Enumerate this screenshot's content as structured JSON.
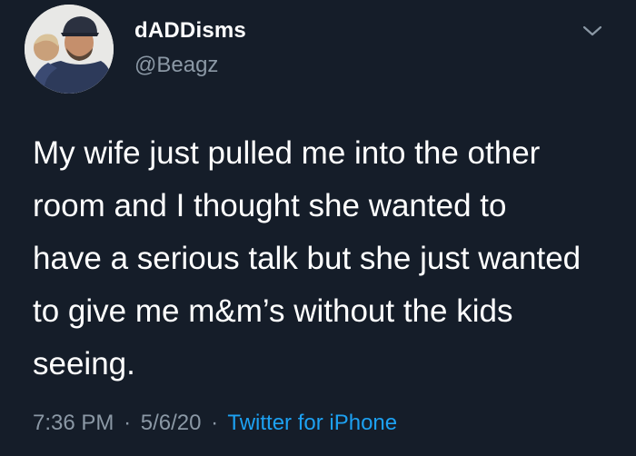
{
  "author": {
    "display_name": "dADDisms",
    "handle": "@Beagz"
  },
  "tweet": {
    "lines": [
      "My wife just pulled me into the other",
      "room and I thought she wanted to",
      "have a serious talk but she just wanted",
      "to give me m&m’s without the kids",
      "seeing."
    ]
  },
  "meta": {
    "time": "7:36 PM",
    "separator": "·",
    "date": "5/6/20",
    "source": "Twitter for iPhone"
  },
  "icons": {
    "menu": "chevron-down-icon",
    "avatar": "profile-photo"
  },
  "colors": {
    "background": "#151d29",
    "text": "#ffffff",
    "secondary": "#8b98a5",
    "link": "#1da1f2"
  }
}
